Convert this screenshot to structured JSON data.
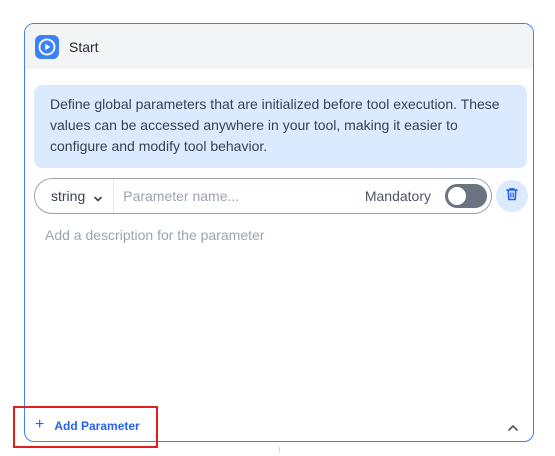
{
  "node": {
    "title": "Start",
    "info_text": "Define global parameters that are initialized before tool execution. These values can be accessed anywhere in your tool, making it easier to configure and modify tool behavior.",
    "accent_color": "#3b82f6"
  },
  "parameter": {
    "type": "string",
    "name_placeholder": "Parameter name...",
    "name_value": "",
    "mandatory_label": "Mandatory",
    "mandatory_on": false,
    "description_placeholder": "Add a description for the parameter"
  },
  "actions": {
    "add_parameter_label": "Add Parameter"
  },
  "icons": {
    "header": "play-icon",
    "type_dropdown": "chevron-down-icon",
    "delete": "trash-icon",
    "add": "plus-icon",
    "collapse": "chevron-up-icon"
  },
  "annotation": {
    "highlight_color": "#e11d1d"
  }
}
